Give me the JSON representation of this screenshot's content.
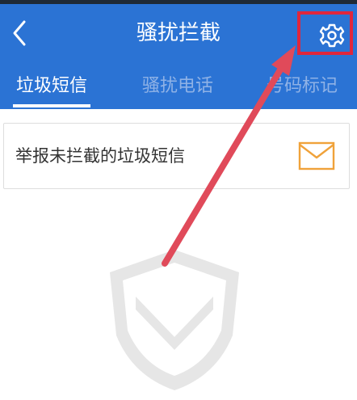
{
  "header": {
    "title": "骚扰拦截",
    "back_icon": "chevron-left-icon",
    "settings_icon": "gear-icon"
  },
  "tabs": [
    {
      "label": "垃圾短信",
      "active": true
    },
    {
      "label": "骚扰电话",
      "active": false
    },
    {
      "label": "号码标记",
      "active": false
    }
  ],
  "report_card": {
    "label": "举报未拦截的垃圾短信",
    "icon": "mail-icon"
  },
  "colors": {
    "header_bg": "#2b73d4",
    "annotation": "#e0263c",
    "mail_icon": "#f0a23a"
  }
}
